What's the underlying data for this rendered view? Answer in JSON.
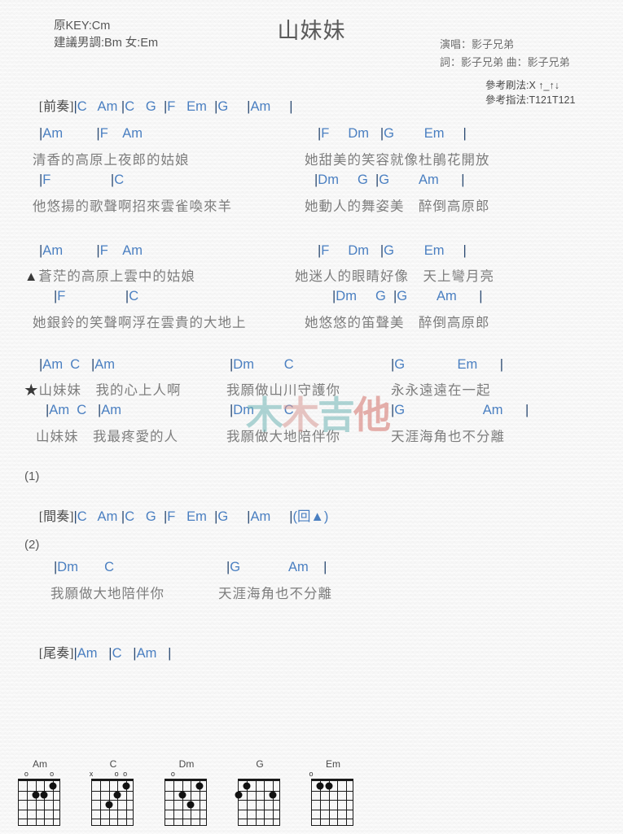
{
  "header": {
    "title": "山妹妹",
    "original_key": "原KEY:Cm",
    "suggested_key": "建議男調:Bm 女:Em",
    "singer": "演唱：影子兄弟",
    "writer": "詞：影子兄弟  曲：影子兄弟",
    "strum_pattern": "參考刷法:X ↑_↑↓",
    "finger_pattern": "參考指法:T121T121"
  },
  "watermark": {
    "c1": "木",
    "c2": "木",
    "c3": "吉",
    "c4": "他"
  },
  "sections": {
    "intro_tag": "[前奏]",
    "intro_chords": "|C   Am |C   G  |F   Em  |G     |Am     |",
    "interlude_tag": "[間奏]",
    "interlude_chords": "|C   Am |C   G  |F   Em  |G     |Am     |(回▲)",
    "outro_tag": "[尾奏]",
    "outro_chords": "|Am   |C   |Am   |",
    "num1": "(1)",
    "num2": "(2)"
  },
  "verse1": {
    "chords_a_left": "|Am         |F    Am",
    "chords_a_right": "|F     Dm   |G        Em     |",
    "lyric_a_left": "清香的高原上夜郎的姑娘",
    "lyric_a_right": "她甜美的笑容就像杜鵑花開放",
    "chords_b_left": "|F                |C",
    "chords_b_right": "|Dm     G  |G        Am      |",
    "lyric_b_left": "他悠揚的歌聲啊招來雲雀喚來羊",
    "lyric_b_right": "她動人的舞姿美　醉倒高原郎"
  },
  "verse2": {
    "marker": "▲",
    "chords_a_left": "|Am         |F    Am",
    "chords_a_right": "|F     Dm   |G        Em     |",
    "lyric_a_left": "蒼茫的高原上雲中的姑娘",
    "lyric_a_right": "她迷人的眼睛好像　天上彎月亮",
    "chords_b_left": "|F                |C",
    "chords_b_right": "|Dm     G  |G        Am      |",
    "lyric_b_left": "她銀鈴的笑聲啊浮在雲貴的大地上",
    "lyric_b_right": "她悠悠的笛聲美　醉倒高原郎"
  },
  "chorus": {
    "marker": "★",
    "chords_a_left": "|Am  C   |Am",
    "chords_a_mid": "|Dm        C",
    "chords_a_right": "|G              Em      |",
    "lyric_a_left": "山妹妹　我的心上人啊",
    "lyric_a_mid": "我願做山川守護你",
    "lyric_a_right": "永永遠遠在一起",
    "chords_b_left": "|Am  C   |Am",
    "chords_b_mid": "|Dm        C",
    "chords_b_right": "|G                     Am      |",
    "lyric_b_left": "山妹妹　我最疼愛的人",
    "lyric_b_mid": "我願做大地陪伴你",
    "lyric_b_right": "天涯海角也不分離"
  },
  "ending": {
    "chords_left": "|Dm       C",
    "chords_right": "|G             Am    |",
    "lyric_left": "我願做大地陪伴你",
    "lyric_right": "天涯海角也不分離"
  },
  "chord_diagrams": [
    {
      "name": "Am",
      "markers": [
        {
          "string": 1,
          "symbol": "o"
        },
        {
          "string": 4,
          "symbol": "o"
        }
      ],
      "dots": [
        {
          "string": 4,
          "fret": 1
        },
        {
          "string": 2,
          "fret": 2
        },
        {
          "string": 3,
          "fret": 2
        }
      ]
    },
    {
      "name": "C",
      "markers": [
        {
          "string": 0,
          "symbol": "x"
        },
        {
          "string": 3,
          "symbol": "o"
        },
        {
          "string": 4,
          "symbol": "o"
        }
      ],
      "dots": [
        {
          "string": 4,
          "fret": 1
        },
        {
          "string": 3,
          "fret": 2
        },
        {
          "string": 2,
          "fret": 3
        }
      ]
    },
    {
      "name": "Dm",
      "markers": [
        {
          "string": 1,
          "symbol": "o"
        }
      ],
      "dots": [
        {
          "string": 4,
          "fret": 1
        },
        {
          "string": 2,
          "fret": 2
        },
        {
          "string": 3,
          "fret": 3
        }
      ]
    },
    {
      "name": "G",
      "markers": [],
      "dots": [
        {
          "string": 1,
          "fret": 1
        },
        {
          "string": 0,
          "fret": 2
        },
        {
          "string": 4,
          "fret": 2
        }
      ]
    },
    {
      "name": "Em",
      "markers": [
        {
          "string": 0,
          "symbol": "o"
        }
      ],
      "dots": [
        {
          "string": 1,
          "fret": 1
        },
        {
          "string": 2,
          "fret": 1
        }
      ]
    }
  ]
}
